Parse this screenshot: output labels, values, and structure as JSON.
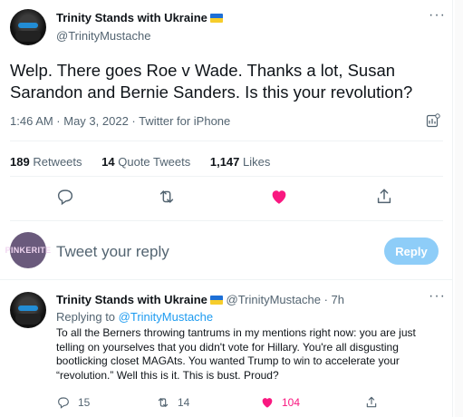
{
  "main_tweet": {
    "display_name": "Trinity Stands with Ukraine",
    "handle": "@TrinityMustache",
    "text": "Welp. There goes Roe v Wade. Thanks a lot, Susan Sarandon and Bernie Sanders. Is this your revolution?",
    "meta": "1:46 AM · May 3, 2022 · Twitter for iPhone",
    "stats": {
      "retweets_count": "189",
      "retweets_label": "Retweets",
      "quotes_count": "14",
      "quotes_label": "Quote Tweets",
      "likes_count": "1,147",
      "likes_label": "Likes"
    }
  },
  "compose": {
    "avatar_text": "PINKERITE",
    "placeholder": "Tweet your reply",
    "reply_button": "Reply"
  },
  "reply_tweet": {
    "display_name": "Trinity Stands with Ukraine",
    "handle_time": "@TrinityMustache · 7h",
    "replying_prefix": "Replying to",
    "replying_to": "@TrinityMustache",
    "text": "To all the Berners throwing tantrums in my mentions right now: you are just telling on yourselves that you didn't vote for Hillary. You're all disgusting bootlicking closet MAGAts. You wanted Trump to win to accelerate your “revolution.” Well this is it. This is bust. Proud?",
    "replies": "15",
    "retweets": "14",
    "likes": "104"
  },
  "colors": {
    "accent": "#1d9bf0",
    "like": "#f91880",
    "reply_button_disabled": "#8ecdf8"
  },
  "icons": [
    "more-icon",
    "analytics-icon",
    "reply-icon",
    "retweet-icon",
    "heart-icon",
    "share-icon",
    "ukraine-flag-icon"
  ]
}
